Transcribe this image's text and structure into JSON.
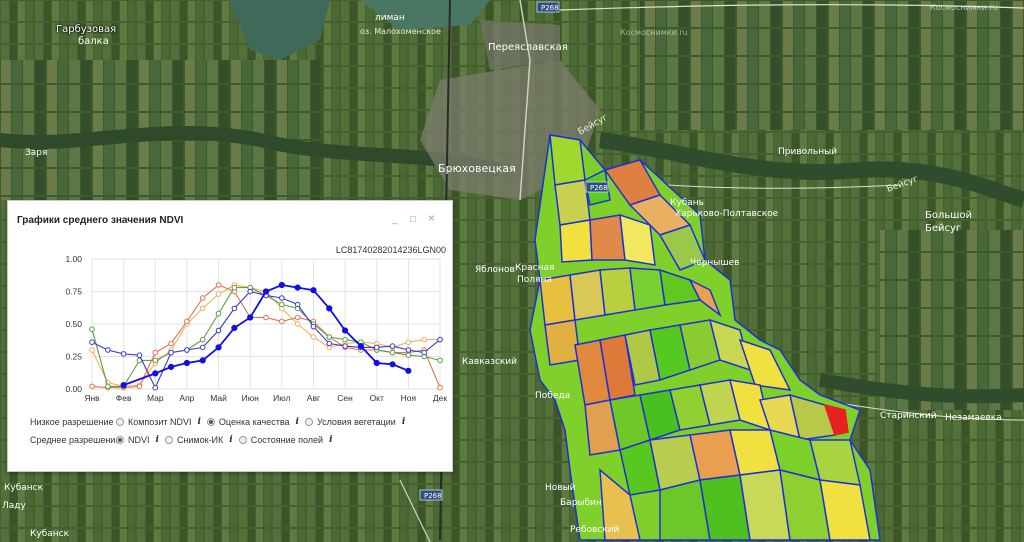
{
  "map": {
    "labels": {
      "garbuzovaya": "Гарбузовая",
      "balka": "балка",
      "liman": "лиман",
      "malokhoventskoe": "оз. Малохоменское",
      "pereyaslovskaya": "Переяславская",
      "bryukhovetskaya": "Брюховецкая",
      "beysug1": "Бейсуг",
      "privolny": "Привольный",
      "beysug2": "Бейсуг",
      "kuban": "Кубань",
      "kharkovo": "Харьково-Полтавское",
      "bolshoy": "Большой",
      "beysug3": "Бейсуг",
      "yablonovskiy": "Яблонов",
      "krasnaya1": "Красная",
      "krasnaya2": "Поляна",
      "chernyshev": "Чернышев",
      "kavkazskiy": "Кавказский",
      "pobeda": "Победа",
      "novyy": "Новый",
      "barybin": "Барыбин",
      "rebovskiy": "Ребовский",
      "starinskiy": "Старинский",
      "nezamaevka": "Незамаевка",
      "zarya": "Заря",
      "kubansk": "Кубанск",
      "ladu": "Ладу",
      "kubansk2": "Кубанск"
    },
    "roads": {
      "r268_top": "Р268",
      "r268_bottom": "Р268",
      "r268_mid": "Р268"
    },
    "watermark": "Космоснимки.ru"
  },
  "panel": {
    "title": "Графики среднего значения NDVI",
    "scene_id": "LC81740282014236LGN00",
    "minimize_icon": "_",
    "maximize_icon": "□",
    "close_icon": "×",
    "row1": {
      "label": "Низкое разрешение",
      "options": [
        {
          "label": "Композит NDVI",
          "selected": false
        },
        {
          "label": "Оценка качества",
          "selected": true
        },
        {
          "label": "Условия вегетации",
          "selected": false
        }
      ]
    },
    "row2": {
      "label": "Среднее разрешение",
      "options": [
        {
          "label": "NDVI",
          "selected": true
        },
        {
          "label": "Снимок-ИК",
          "selected": false
        },
        {
          "label": "Состояние полей",
          "selected": false
        }
      ]
    },
    "info_icon": "i"
  },
  "chart_data": {
    "type": "line",
    "categories": [
      "Янв",
      "Фев",
      "Мар",
      "Апр",
      "Май",
      "Июн",
      "Июл",
      "Авг",
      "Сен",
      "Окт",
      "Ноя",
      "Дек"
    ],
    "yticks": [
      "0.00",
      "0.25",
      "0.50",
      "0.75",
      "1.00"
    ],
    "ylim": [
      0,
      1
    ],
    "grid": true,
    "series": [
      {
        "color": "#f0b060",
        "x": [
          0.0,
          0.5,
          1.0,
          1.5,
          2.0,
          2.5,
          3.0,
          3.5,
          4.0,
          4.5,
          5.0,
          5.5,
          6.0,
          6.5,
          7.0,
          7.5,
          8.0,
          8.5,
          9.0,
          9.5,
          10.0,
          10.5,
          11.0
        ],
        "y": [
          0.3,
          0.05,
          0.02,
          0.03,
          0.2,
          0.3,
          0.5,
          0.62,
          0.73,
          0.8,
          0.78,
          0.75,
          0.62,
          0.5,
          0.4,
          0.32,
          0.35,
          0.36,
          0.35,
          0.32,
          0.36,
          0.38,
          0.38
        ]
      },
      {
        "color": "#e87050",
        "x": [
          0.0,
          0.5,
          1.0,
          1.5,
          2.0,
          2.5,
          3.0,
          3.5,
          4.0,
          4.5,
          5.0,
          5.5,
          6.0,
          6.5,
          7.0,
          7.5,
          8.0,
          8.5,
          9.0,
          9.5,
          10.0,
          10.5,
          11.0
        ],
        "y": [
          0.02,
          0.01,
          0.01,
          0.02,
          0.28,
          0.35,
          0.52,
          0.7,
          0.8,
          0.75,
          0.55,
          0.55,
          0.52,
          0.55,
          0.52,
          0.4,
          0.32,
          0.3,
          0.3,
          0.28,
          0.28,
          0.3,
          0.01
        ]
      },
      {
        "color": "#5aa040",
        "x": [
          0.0,
          0.5,
          1.0,
          1.5,
          2.0,
          2.5,
          3.0,
          3.5,
          4.0,
          4.5,
          5.0,
          5.5,
          6.0,
          6.5,
          7.0,
          7.5,
          8.0,
          8.5,
          9.0,
          9.5,
          10.0,
          10.5,
          11.0
        ],
        "y": [
          0.46,
          0.02,
          0.02,
          0.22,
          0.22,
          0.28,
          0.3,
          0.38,
          0.58,
          0.78,
          0.78,
          0.72,
          0.65,
          0.62,
          0.5,
          0.4,
          0.38,
          0.36,
          0.3,
          0.28,
          0.26,
          0.25,
          0.22
        ]
      },
      {
        "color": "#3a3ad0",
        "x": [
          0.0,
          0.5,
          1.0,
          1.5,
          2.0,
          2.5,
          3.0,
          3.5,
          4.0,
          4.5,
          5.0,
          5.5,
          6.0,
          6.5,
          7.0,
          7.5,
          8.0,
          8.5,
          9.0,
          9.5,
          10.0,
          10.5,
          11.0
        ],
        "y": [
          0.36,
          0.3,
          0.27,
          0.26,
          0.01,
          0.28,
          0.3,
          0.32,
          0.45,
          0.62,
          0.75,
          0.72,
          0.7,
          0.65,
          0.48,
          0.35,
          0.33,
          0.32,
          0.32,
          0.33,
          0.3,
          0.28,
          0.38
        ]
      },
      {
        "color": "#1010e0",
        "x": [
          1.0,
          2.0,
          2.5,
          3.0,
          3.5,
          4.0,
          4.5,
          5.0,
          5.5,
          6.0,
          6.5,
          7.0,
          7.5,
          8.0,
          8.5,
          9.0,
          9.5,
          10.0
        ],
        "y": [
          0.03,
          0.12,
          0.17,
          0.2,
          0.22,
          0.32,
          0.47,
          0.55,
          0.75,
          0.8,
          0.78,
          0.76,
          0.62,
          0.45,
          0.33,
          0.2,
          0.19,
          0.14
        ]
      }
    ]
  }
}
